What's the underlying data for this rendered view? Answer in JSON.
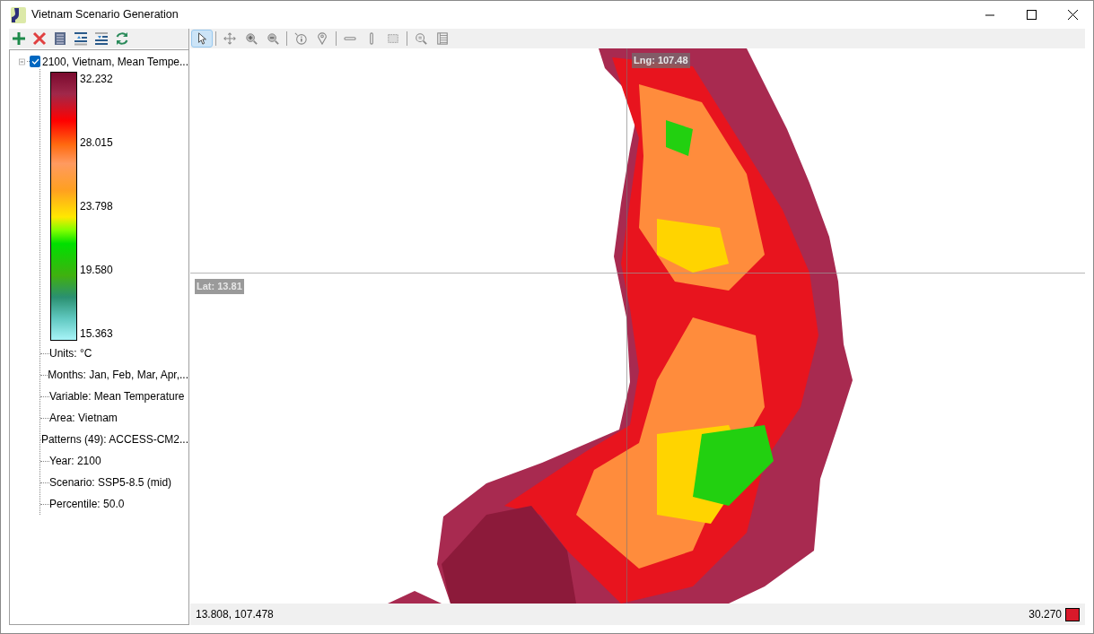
{
  "window": {
    "title": "Vietnam Scenario Generation"
  },
  "layer_toolbar": {
    "buttons": [
      {
        "kind": "add"
      },
      {
        "kind": "remove"
      },
      {
        "kind": "list"
      },
      {
        "kind": "move-up"
      },
      {
        "kind": "move-down"
      },
      {
        "kind": "refresh"
      }
    ]
  },
  "map_toolbar": {
    "tools": [
      {
        "kind": "select",
        "selected": true
      },
      {
        "kind": "pan",
        "selected": false
      },
      {
        "kind": "zoom-in",
        "selected": false
      },
      {
        "kind": "zoom-out",
        "selected": false
      },
      {
        "kind": "info",
        "selected": false
      },
      {
        "kind": "pin",
        "selected": false
      },
      {
        "kind": "horizontal",
        "selected": false
      },
      {
        "kind": "vertical",
        "selected": false
      },
      {
        "kind": "rectangle",
        "selected": false
      },
      {
        "kind": "zoom-extent",
        "selected": false
      },
      {
        "kind": "table",
        "selected": false
      }
    ]
  },
  "tree": {
    "label": "2100, Vietnam, Mean Tempe...",
    "checked": true,
    "expanded": true,
    "legend": {
      "ticks": [
        "32.232",
        "28.015",
        "23.798",
        "19.580",
        "15.363"
      ]
    },
    "children": [
      {
        "label": "Units: °C"
      },
      {
        "label": "Months: Jan, Feb, Mar, Apr,..."
      },
      {
        "label": "Variable: Mean Temperature"
      },
      {
        "label": "Area: Vietnam"
      },
      {
        "label": "Patterns (49): ACCESS-CM2..."
      },
      {
        "label": "Year: 2100"
      },
      {
        "label": "Scenario: SSP5-8.5 (mid)"
      },
      {
        "label": "Percentile: 50.0"
      }
    ]
  },
  "map": {
    "lng_label": "Lng: 107.48",
    "lat_label": "Lat: 13.81"
  },
  "status_bar": {
    "coordinates": "13.808, 107.478",
    "value": "30.270"
  }
}
